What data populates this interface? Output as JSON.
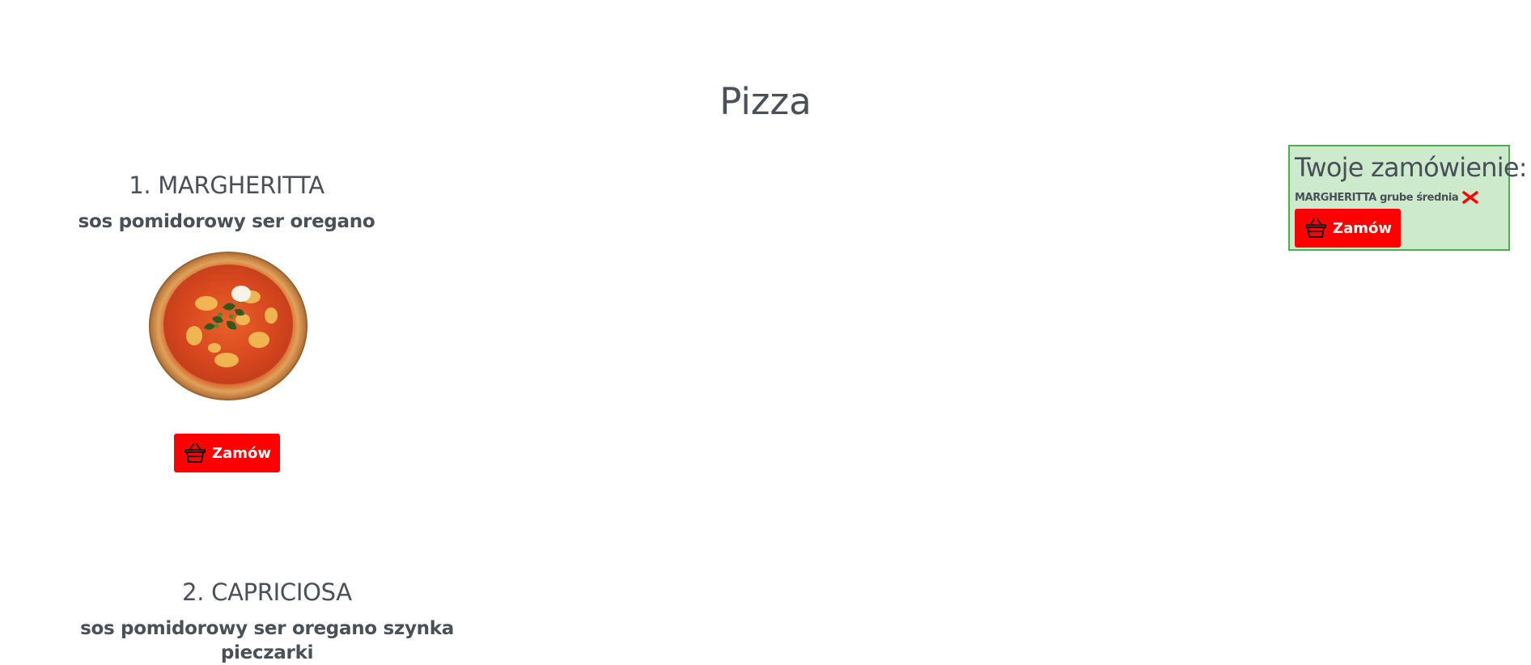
{
  "page": {
    "title": "Pizza"
  },
  "menu": [
    {
      "name": "1. MARGHERITTA",
      "ingredients": "sos pomidorowy ser oregano",
      "order_label": "Zamów"
    },
    {
      "name": "2. CAPRICIOSA",
      "ingredients": "sos pomidorowy ser oregano szynka pieczarki"
    }
  ],
  "cart": {
    "title": "Twoje zamówienie:",
    "items": [
      {
        "text": "MARGHERITTA grube średnia"
      }
    ],
    "order_label": "Zamów"
  },
  "icons": {
    "order": "basket-icon",
    "remove": "remove-x-icon"
  },
  "colors": {
    "accent": "#ff0000",
    "text": "#495057",
    "cart_background": "#cdeacd",
    "cart_border": "#4caf50"
  }
}
